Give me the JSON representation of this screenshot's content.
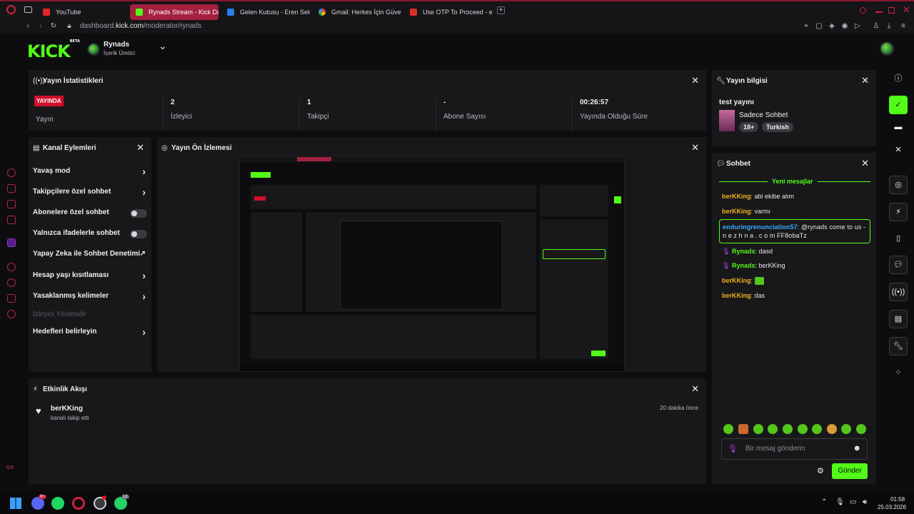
{
  "browser": {
    "tabs": [
      {
        "label": "YouTube",
        "color": "#e5252a"
      },
      {
        "label": "Rynads Stream - Kick Dash",
        "color": "#53fc18"
      },
      {
        "label": "Gelen Kutusu - Eren Selçuk",
        "color": "#2b7de9"
      },
      {
        "label": "Gmail: Herkes İçin Güvenli",
        "color": "#e9e9e9"
      },
      {
        "label": "Use OTP To Proceed - eren",
        "color": "#d93025"
      }
    ],
    "new_tab": "+",
    "url_prefix": "dashboard.",
    "url_domain": "kick.com",
    "url_path": "/moderator/rynads"
  },
  "header": {
    "logo": "KICK",
    "logo_badge": "BETA",
    "channel_name": "Rynads",
    "channel_role": "İçerik Üretici",
    "dropdown": "⌄"
  },
  "stats": {
    "title": "Yayın İstatistikleri",
    "live_badge": "YAYINDA",
    "cells": [
      {
        "value": "",
        "label": "Yayın"
      },
      {
        "value": "2",
        "label": "İzleyici"
      },
      {
        "value": "1",
        "label": "Takipçi"
      },
      {
        "value": "-",
        "label": "Abone Sayısı"
      },
      {
        "value": "00:26:57",
        "label": "Yayında Olduğu Süre"
      }
    ]
  },
  "stream_info": {
    "title": "Yayın bilgisi",
    "stream_title": "test yayını",
    "category": "Sadece Sohbet",
    "tags": [
      "18+",
      "Turkish"
    ]
  },
  "channel_actions": {
    "title": "Kanal Eylemleri",
    "items": [
      {
        "label": "Yavaş mod",
        "kind": "chevron"
      },
      {
        "label": "Takipçilere özel sohbet",
        "kind": "chevron"
      },
      {
        "label": "Abonelere özel sohbet",
        "kind": "toggle"
      },
      {
        "label": "Yalnızca ifadelerle sohbet",
        "kind": "toggle"
      },
      {
        "label": "Yapay Zeka ile Sohbet Denetimi",
        "kind": "external"
      },
      {
        "label": "Hesap yaşı kısıtlaması",
        "kind": "chevron"
      },
      {
        "label": "Yasaklanmış kelimeler",
        "kind": "chevron"
      },
      {
        "label": "İzleyici Yönlendir",
        "kind": "disabled"
      },
      {
        "label": "Hedefleri belirleyin",
        "kind": "chevron"
      }
    ]
  },
  "preview": {
    "title": "Yayın Ön İzlemesi"
  },
  "activity": {
    "title": "Etkinlik Akışı",
    "items": [
      {
        "user": "berKKing",
        "action": "kanalı takip etti",
        "time": "20 dakika önce"
      }
    ]
  },
  "chat": {
    "title": "Sohbet",
    "new_messages": "Yeni mesajlar",
    "messages": [
      {
        "user": "berKKing",
        "text": "abi ekibe alım",
        "color": "#f2b318"
      },
      {
        "user": "berKKing",
        "text": "varmı",
        "color": "#f2b318"
      },
      {
        "user": "enduringrenunciation57",
        "text": "@rynads come to us - n e z h n a . c o m FF8obaTz",
        "color": "#3ea6ff"
      },
      {
        "user": "Rynads",
        "text": "dasd",
        "color": "#53fc18"
      },
      {
        "user": "Rynads",
        "text": "berKKing",
        "color": "#53fc18"
      },
      {
        "user": "berKKing",
        "text": "",
        "color": "#f2b318"
      },
      {
        "user": "berKKing",
        "text": "das",
        "color": "#f2b318"
      }
    ],
    "placeholder": "Bir mesaj gönderin",
    "send_label": "Gönder"
  },
  "taskbar": {
    "time": "01:58",
    "date": "25.03.2026",
    "discord_badge": "9+",
    "whatsapp_badge": "12"
  },
  "accent": "#53fc18"
}
